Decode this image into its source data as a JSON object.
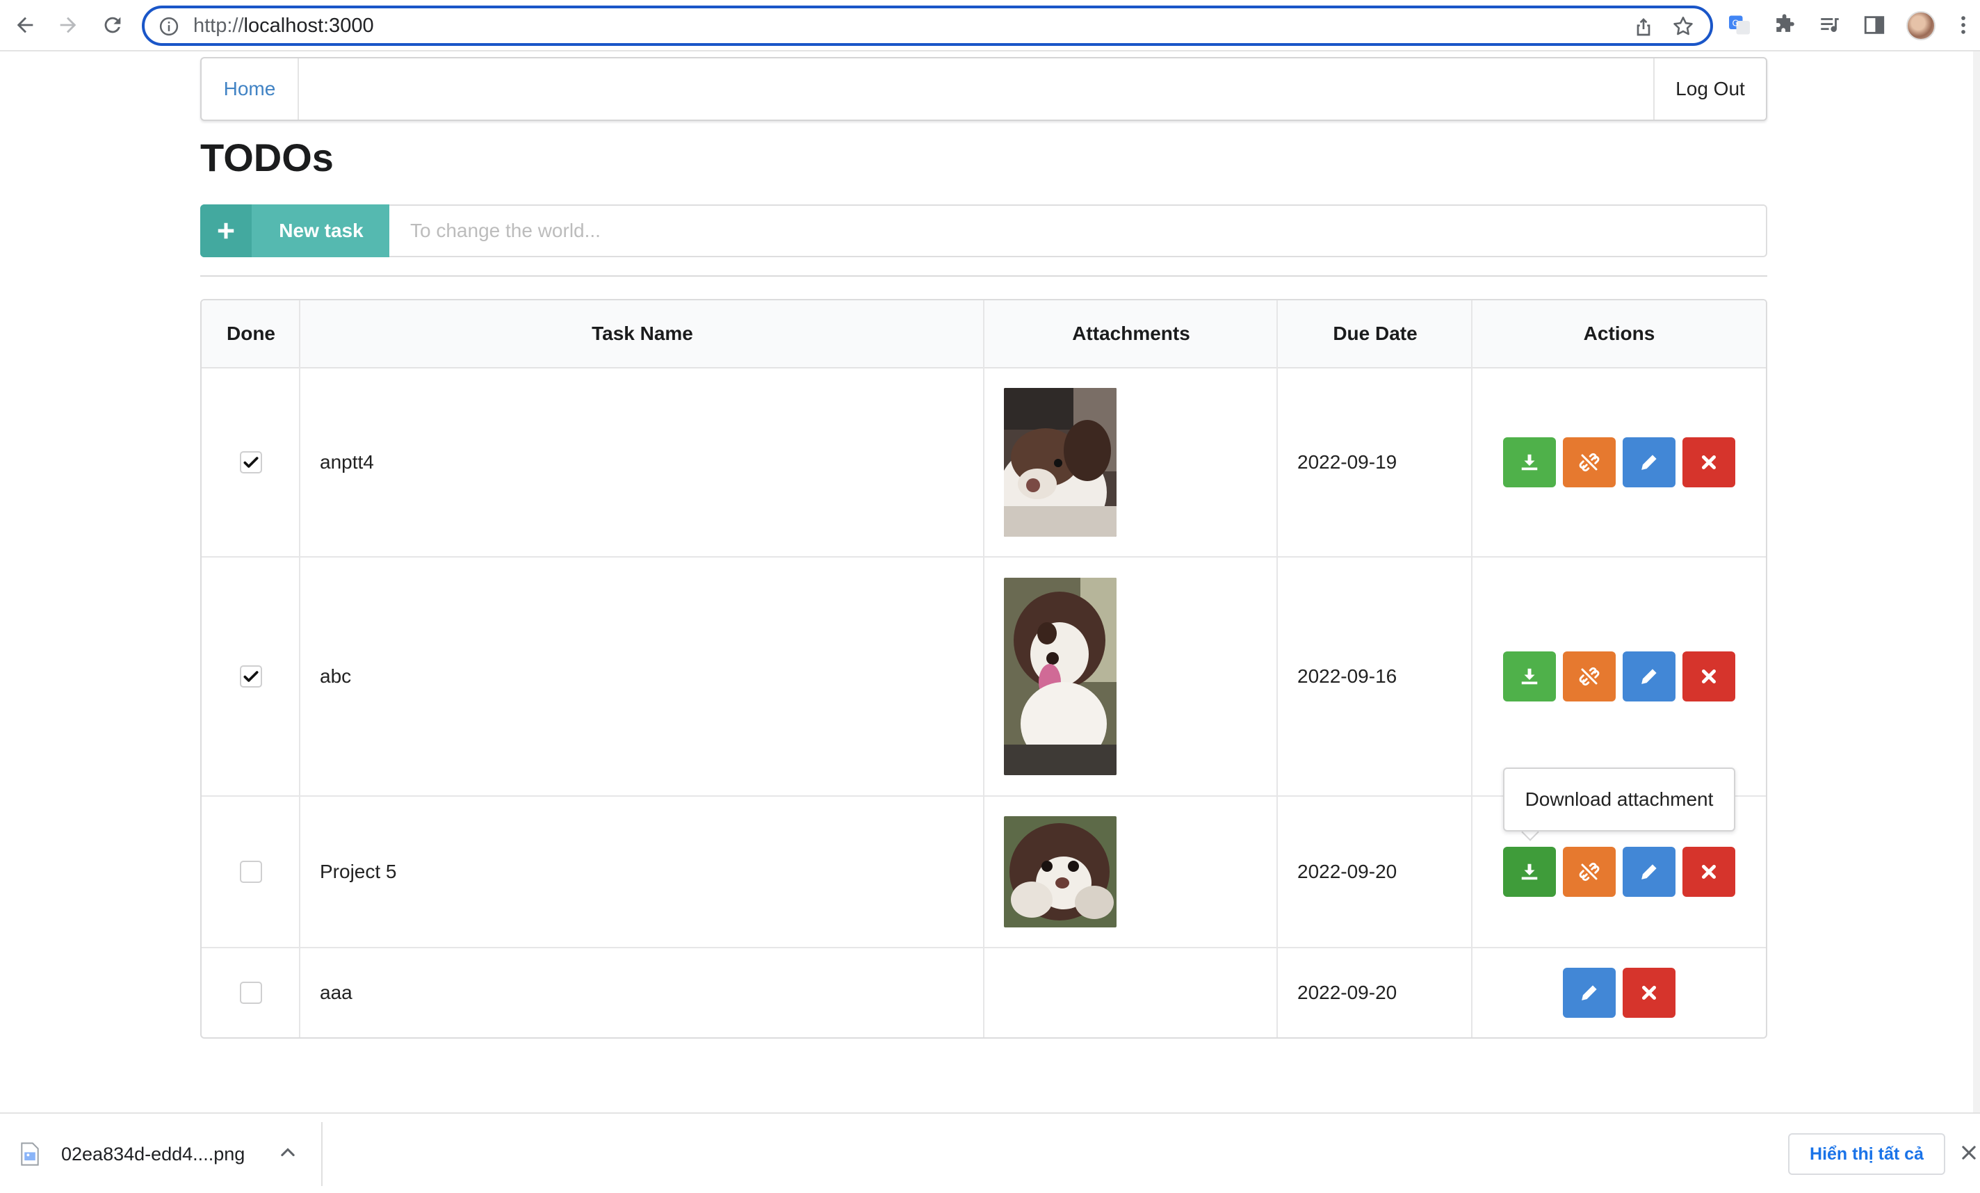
{
  "browser": {
    "url_scheme": "http://",
    "url_host": "localhost:3000"
  },
  "nav": {
    "home_label": "Home",
    "logout_label": "Log Out"
  },
  "page": {
    "title": "TODOs"
  },
  "new_task": {
    "button_label": "New task",
    "input_placeholder": "To change the world...",
    "input_value": ""
  },
  "table": {
    "headers": {
      "done": "Done",
      "task_name": "Task Name",
      "attachments": "Attachments",
      "due_date": "Due Date",
      "actions": "Actions"
    },
    "rows": [
      {
        "done": true,
        "name": "anptt4",
        "due": "2022-09-19",
        "has_attachment": true
      },
      {
        "done": true,
        "name": "abc",
        "due": "2022-09-16",
        "has_attachment": true
      },
      {
        "done": false,
        "name": "Project 5",
        "due": "2022-09-20",
        "has_attachment": true
      },
      {
        "done": false,
        "name": "aaa",
        "due": "2022-09-20",
        "has_attachment": false
      }
    ]
  },
  "tooltip": {
    "text": "Download attachment"
  },
  "download_bar": {
    "file_name": "02ea834d-edd4....png",
    "show_all_label": "Hiển thị tất cả"
  },
  "colors": {
    "accent_teal": "#55b9b0",
    "green": "#4fb14a",
    "orange": "#e6792f",
    "blue": "#4287d6",
    "red": "#d6342c",
    "link": "#4183c4"
  },
  "icons": {
    "download": "download-icon",
    "remove_attachment": "unlink-icon",
    "edit": "pencil-icon",
    "delete": "close-icon",
    "add": "plus-icon"
  }
}
